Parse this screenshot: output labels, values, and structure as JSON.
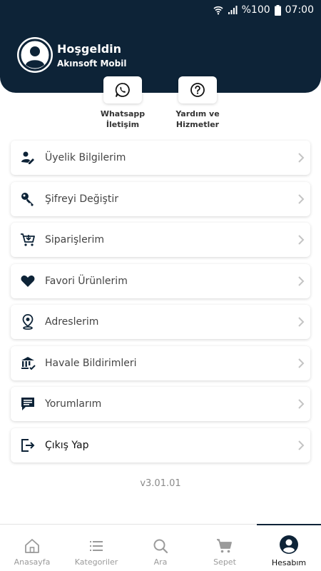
{
  "status_bar": {
    "battery": "%100",
    "time": "07:00"
  },
  "header": {
    "greeting": "Hoşgeldin",
    "subtitle": "Akınsoft Mobil"
  },
  "quick_actions": [
    {
      "label": "Whatsapp\nİletişim",
      "icon": "whatsapp-icon"
    },
    {
      "label": "Yardım ve\nHizmetler",
      "icon": "help-icon"
    }
  ],
  "menu": [
    {
      "label": "Üyelik Bilgilerim",
      "icon": "user-edit-icon"
    },
    {
      "label": "Şifreyi Değiştir",
      "icon": "key-icon"
    },
    {
      "label": "Siparişlerim",
      "icon": "cart-icon"
    },
    {
      "label": "Favori Ürünlerim",
      "icon": "heart-icon"
    },
    {
      "label": "Adreslerim",
      "icon": "location-pin-icon"
    },
    {
      "label": "Havale Bildirimleri",
      "icon": "bank-icon"
    },
    {
      "label": "Yorumlarım",
      "icon": "comment-icon"
    },
    {
      "label": "Çıkış Yap",
      "icon": "logout-icon"
    }
  ],
  "version": "v3.01.01",
  "bottom_nav": [
    {
      "label": "Anasayfa",
      "icon": "home-icon"
    },
    {
      "label": "Kategoriler",
      "icon": "list-icon"
    },
    {
      "label": "Ara",
      "icon": "search-icon"
    },
    {
      "label": "Sepet",
      "icon": "cart-icon"
    },
    {
      "label": "Hesabım",
      "icon": "account-icon",
      "active": true
    }
  ],
  "colors": {
    "primary": "#0d2337",
    "muted": "#9b9b9b",
    "chevron": "#c4c4c4"
  }
}
